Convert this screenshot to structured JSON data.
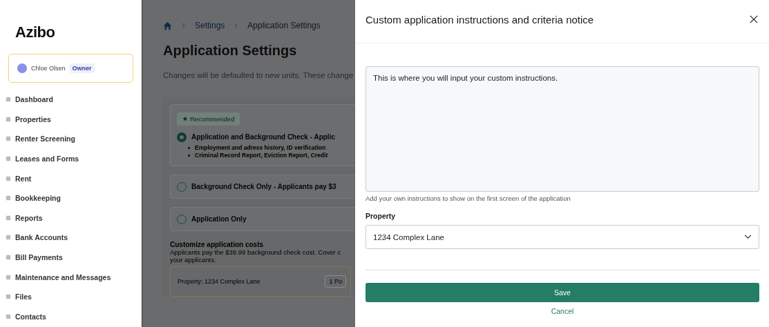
{
  "sidebar": {
    "logo": "Azibo",
    "user": {
      "name": "Chloe Olsen",
      "role": "Owner"
    },
    "items": [
      {
        "label": "Dashboard"
      },
      {
        "label": "Properties"
      },
      {
        "label": "Renter Screening"
      },
      {
        "label": "Leases and Forms"
      },
      {
        "label": "Rent"
      },
      {
        "label": "Bookkeeping"
      },
      {
        "label": "Reports"
      },
      {
        "label": "Bank Accounts"
      },
      {
        "label": "Bill Payments"
      },
      {
        "label": "Maintenance and Messages"
      },
      {
        "label": "Files"
      },
      {
        "label": "Contacts"
      }
    ]
  },
  "main": {
    "breadcrumb": [
      "Settings",
      "Application Settings"
    ],
    "title": "Application Settings",
    "subtitle": "Changes will be defaulted to new units. These change",
    "badge": "Recommended",
    "options": [
      {
        "label": "Application and Background Check - Applic",
        "selected": true,
        "bullets": [
          "Employment and adress history, ID verification",
          "Criminal Record Report, Eviction Report, Credit"
        ]
      },
      {
        "label": "Background Check Only - Applicants pay $3",
        "selected": false
      },
      {
        "label": "Application Only",
        "selected": false
      }
    ],
    "costs": {
      "heading": "Customize application costs",
      "text": "Applicants pay the $39.99 background check cost. Cover c",
      "text_2": "your applicants.",
      "property": "Property: 1234 Complex Lane",
      "select": "1 Po"
    }
  },
  "drawer": {
    "title": "Custom application instructions and criteria notice",
    "instructions": "This is where you will input your custom instructions.",
    "hint": "Add your own instructions to show on the first screen of the application",
    "property_label": "Property",
    "property": "1234 Complex Lane",
    "save": "Save",
    "cancel": "Cancel"
  }
}
